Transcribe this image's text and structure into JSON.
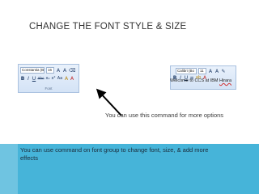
{
  "slide": {
    "title": "CHANGE THE FONT STYLE & SIZE",
    "annotation": "You can use this command for more options",
    "footer_text": "You can use command on font group to change font, size, & add more effects"
  },
  "ribbon_left": {
    "font_name": "Constantia (Body",
    "font_size": "16",
    "row1_buttons": [
      "A",
      "A",
      "⌫"
    ],
    "row2_buttons": [
      "B",
      "I",
      "U",
      "abc",
      "x₂",
      "x²",
      "Aa",
      "A",
      "A"
    ],
    "group_label": "Font"
  },
  "ribbon_right": {
    "font_name": "Calibri (Bo",
    "font_size": "11",
    "row1_buttons": [
      "A",
      "A",
      "✎"
    ],
    "row2_buttons": [
      "B",
      "I",
      "U",
      "≡",
      "ab",
      "A"
    ],
    "document_text_before": "Welcome to CCS at IBM ",
    "document_text_spell": "Hirara"
  },
  "colors": {
    "band": "#46b4d9",
    "arrow": "#000000",
    "title": "#333333"
  }
}
